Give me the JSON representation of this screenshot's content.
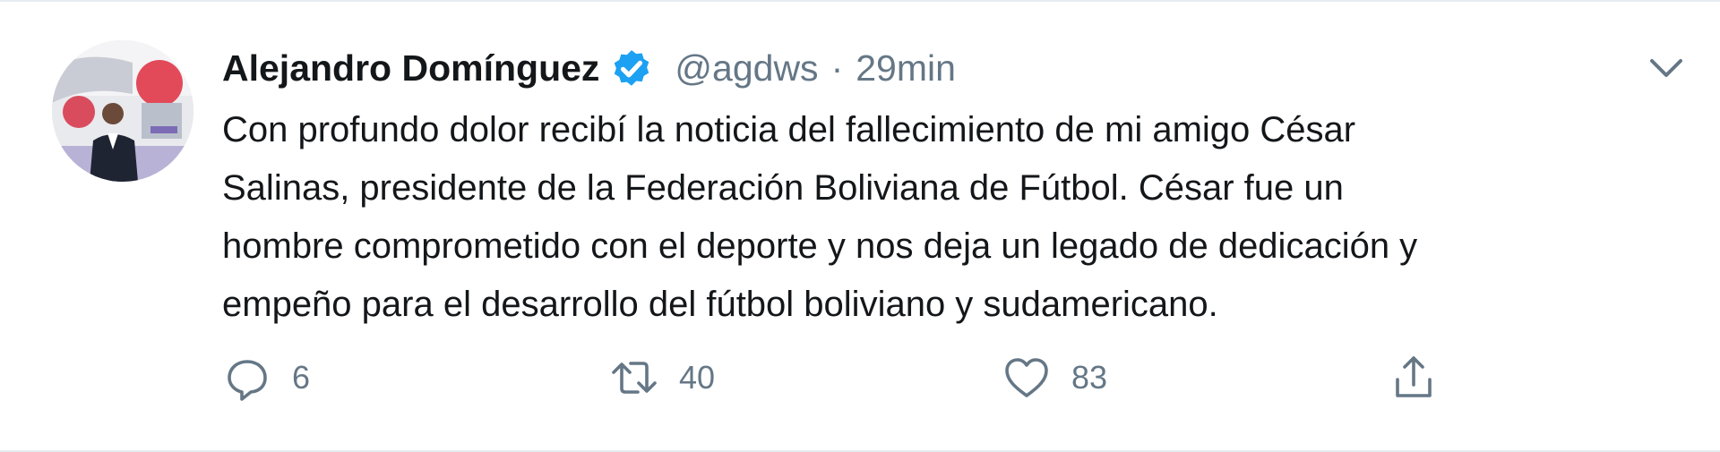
{
  "tweet": {
    "author": {
      "name": "Alejandro Domínguez",
      "handle": "@agdws",
      "verified": true,
      "avatar_icon": "profile-photo"
    },
    "separator": "·",
    "time": "29min",
    "text_lines": [
      "Con profundo dolor recibí la noticia del fallecimiento de mi amigo César",
      "Salinas, presidente de la Federación Boliviana de Fútbol. César fue un",
      "hombre comprometido con el deporte y nos deja un legado de dedicación y",
      "empeño para el desarrollo del fútbol boliviano y sudamericano."
    ],
    "actions": {
      "reply": {
        "icon": "reply-icon",
        "count": "6"
      },
      "retweet": {
        "icon": "retweet-icon",
        "count": "40"
      },
      "like": {
        "icon": "heart-icon",
        "count": "83"
      },
      "share": {
        "icon": "share-icon"
      }
    }
  },
  "colors": {
    "text": "#14171a",
    "secondary": "#657786",
    "verified": "#1da1f2",
    "border": "#e6ecf0"
  }
}
